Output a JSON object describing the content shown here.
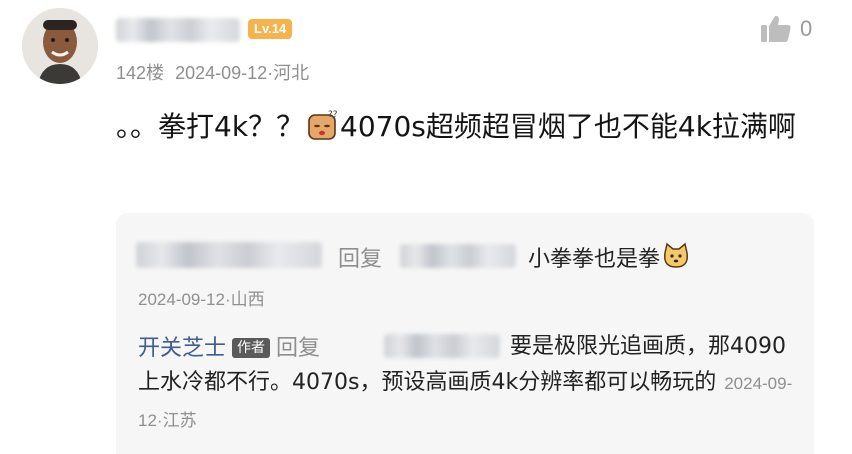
{
  "comment": {
    "level_badge": "Lv.14",
    "like_count": "0",
    "floor": "142楼",
    "date": "2024-09-12",
    "location": "河北",
    "text_part1": "。。拳打4k？？",
    "text_part2": "4070s超频超冒烟了也不能4k拉满啊"
  },
  "replies": [
    {
      "reply_word": "回复",
      "text": "小拳拳也是拳",
      "date": "2024-09-12",
      "location": "山西"
    },
    {
      "author": "开关芝士",
      "author_tag": "作者",
      "reply_word": "回复",
      "text": "要是极限光追画质，那4090上水冷都不行。4070s，预设高画质4k分辨率都可以畅玩的",
      "date": "2024-09-12",
      "location": "江苏"
    }
  ],
  "icons": {
    "like": "thumbs-up-icon",
    "emoji1": "confused-face-emoji-icon",
    "emoji2": "cat-face-emoji-icon"
  }
}
